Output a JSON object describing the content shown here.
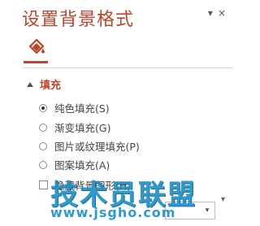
{
  "pane": {
    "title": "设置背景格式",
    "controls": {
      "menu": "▾",
      "close": "×"
    }
  },
  "tabs": [
    {
      "icon": "fill-bucket-icon",
      "active": true
    }
  ],
  "accent_color": "#b7472a",
  "section": {
    "label": "填充",
    "expanded": true
  },
  "fill_options": [
    {
      "label": "纯色填充(S)",
      "checked": true
    },
    {
      "label": "渐变填充(G)",
      "checked": false
    },
    {
      "label": "图片或纹理填充(P)",
      "checked": false
    },
    {
      "label": "图案填充(A)",
      "checked": false
    }
  ],
  "hide_background_graphics": {
    "label": "隐藏背景图形(H)",
    "checked": false
  },
  "color_dropdown": {
    "arrow": "▾"
  },
  "watermark": {
    "title": "技术员联盟",
    "url": "www.jsgho.com",
    "color": "#1b8fc7"
  }
}
